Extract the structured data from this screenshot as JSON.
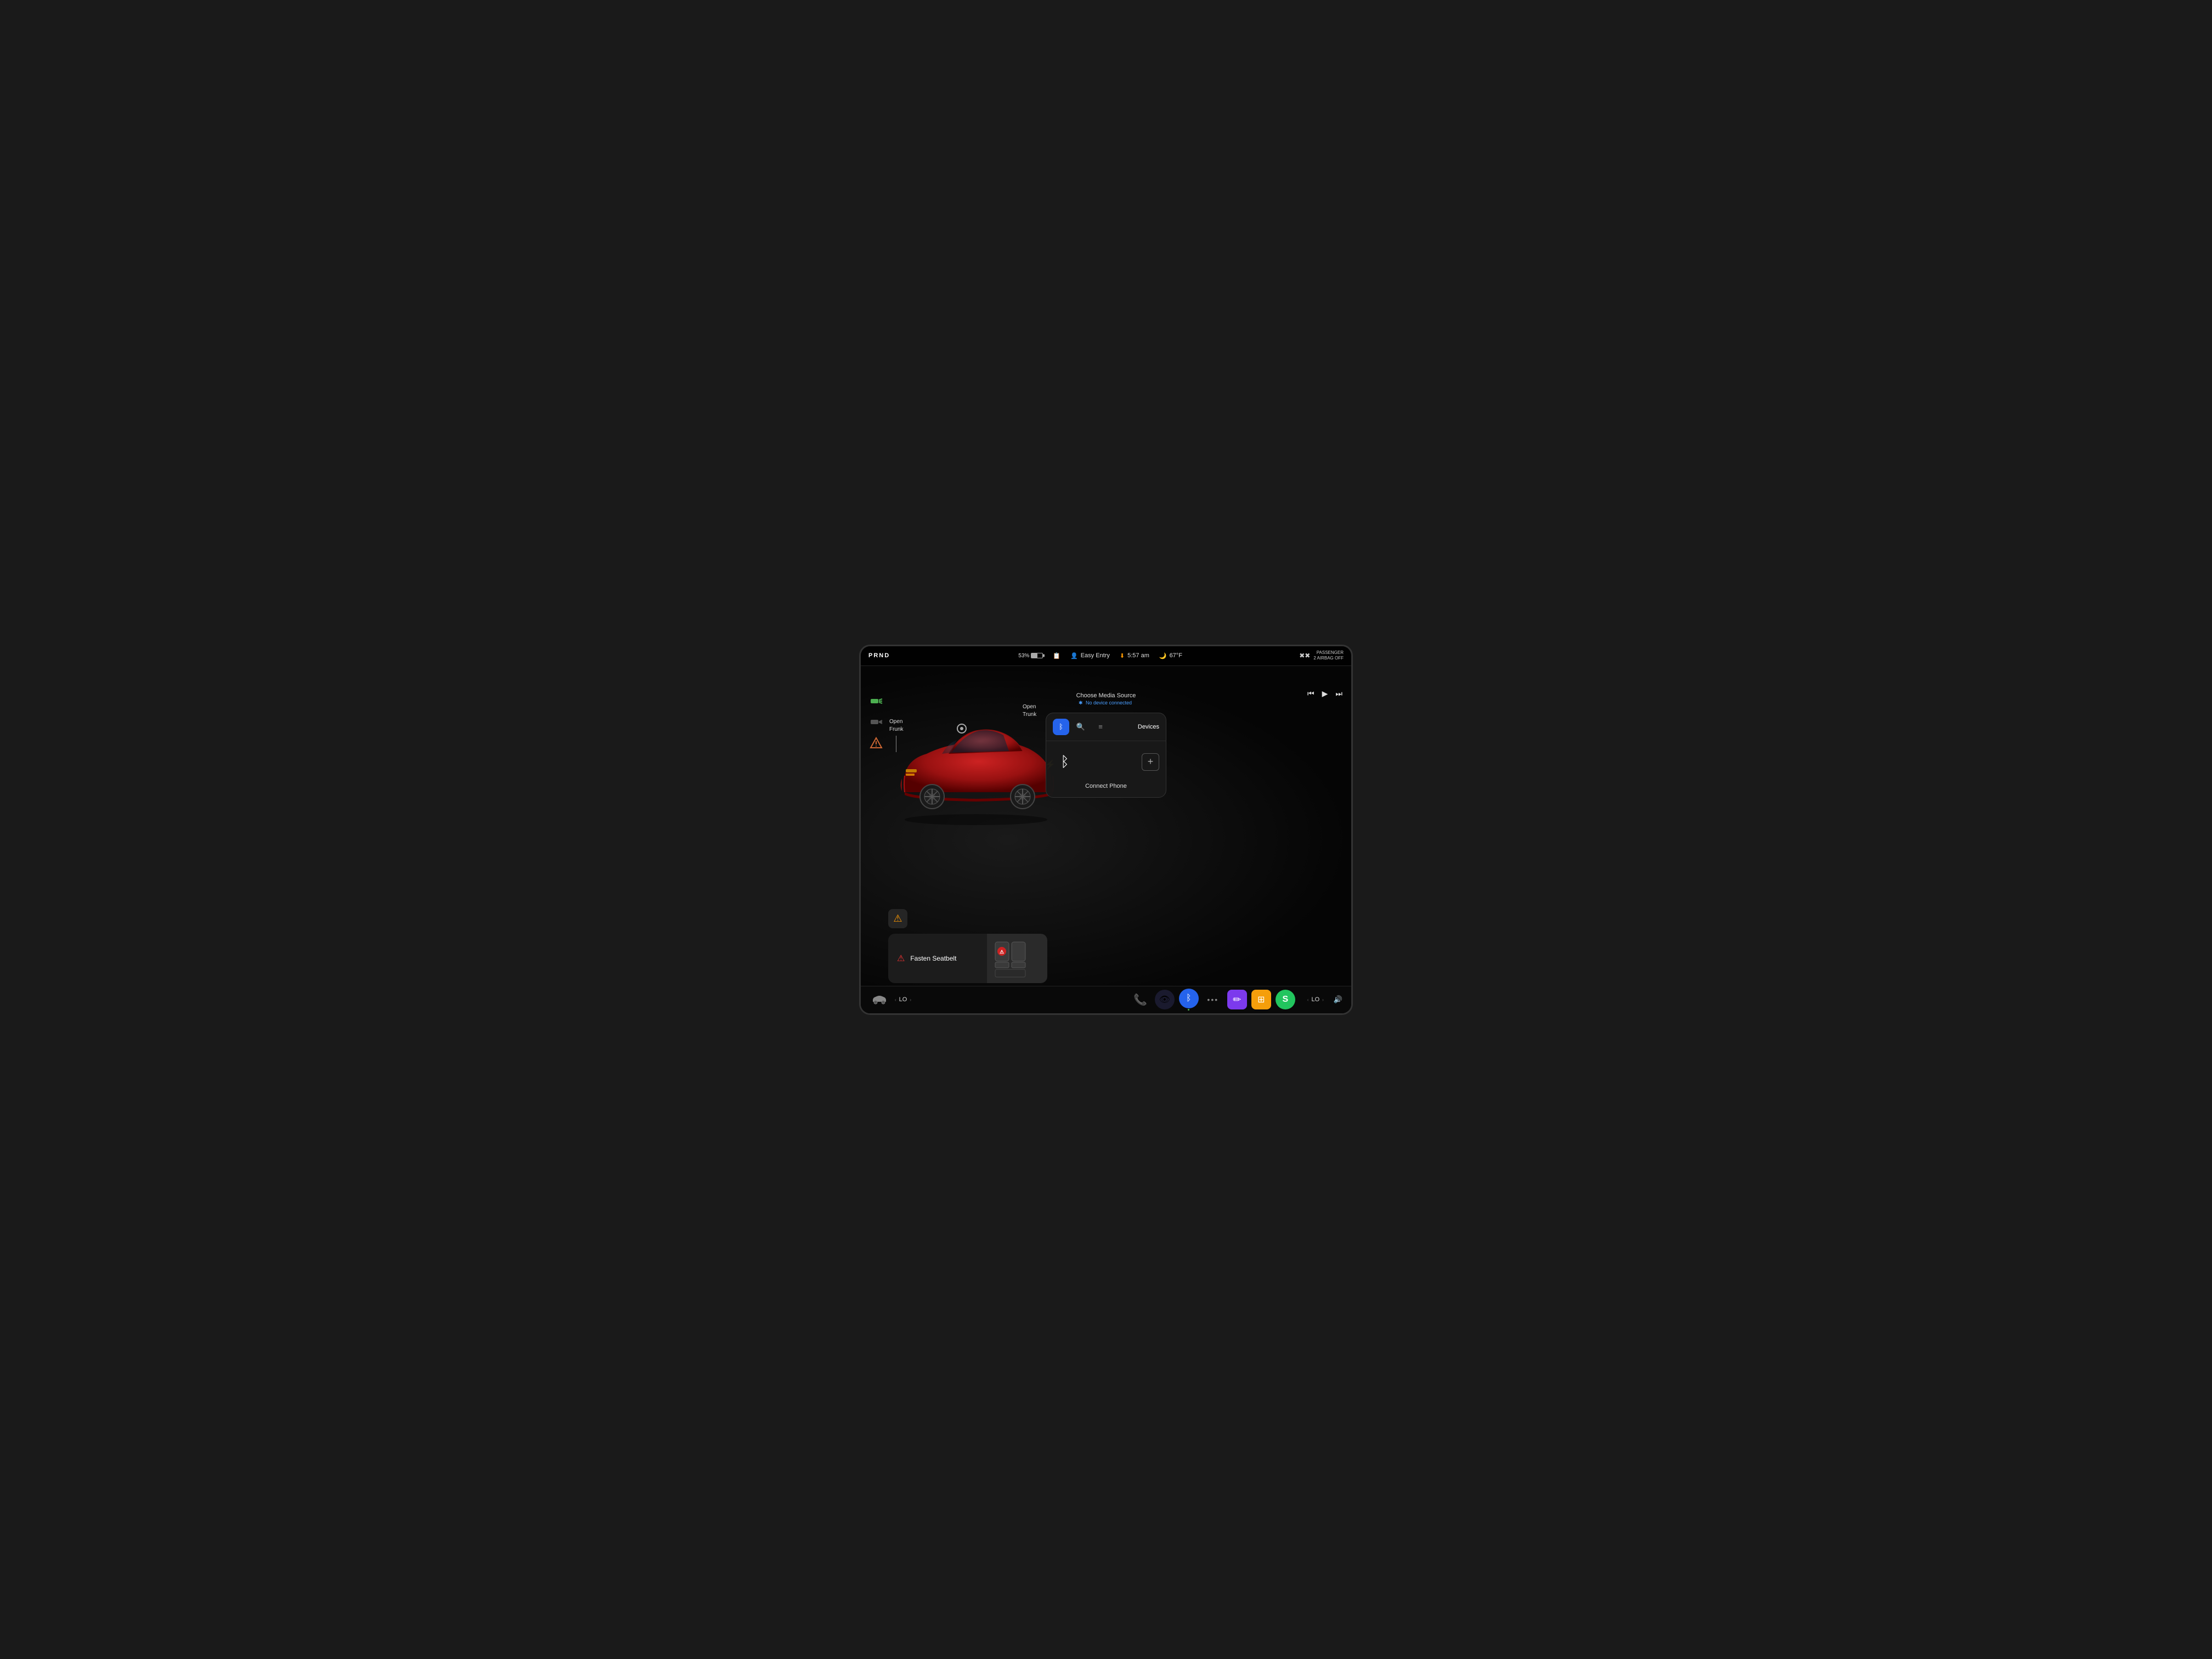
{
  "statusBar": {
    "prnd": "PRND",
    "battery": "53%",
    "easyEntry": "Easy Entry",
    "time": "5:57 am",
    "temperature": "67°F",
    "passengerAirbag": "PASSENGER AIRBAG OFF",
    "passengerAirbagLine2": "2"
  },
  "leftIcons": {
    "headlightsIcon": "💡",
    "beamIcon": "🔆",
    "hazardIcon": "🔥"
  },
  "carLabels": {
    "openFrunk": "Open\nFrunk",
    "openTrunk": "Open\nTrunk",
    "chargeIcon": "⚡"
  },
  "mediaSource": {
    "title": "Choose Media Source",
    "subtitle": "No device connected",
    "bluetoothIcon": "✱"
  },
  "mediaControls": {
    "prevIcon": "⏮",
    "playIcon": "▶",
    "nextIcon": "⏭"
  },
  "bluetoothPanel": {
    "tabBluetooth": "bluetooth",
    "tabSearch": "search",
    "tabList": "list",
    "tabLabel": "Devices",
    "connectLabel": "Connect Phone",
    "addIcon": "+"
  },
  "warnings": {
    "warningIcon": "⚠",
    "seatbeltText": "Fasten Seatbelt",
    "seatbeltIcon": "⚠"
  },
  "taskbar": {
    "carIcon": "🚗",
    "leftTempLabel": "LO",
    "rightTempLabel": "LO",
    "apps": [
      {
        "name": "phone",
        "icon": "📞",
        "bg": "transparent"
      },
      {
        "name": "camera",
        "icon": "📷",
        "bg": "#1a1a2e"
      },
      {
        "name": "bluetooth",
        "icon": "ᛒ",
        "bg": "#2563eb"
      },
      {
        "name": "dots",
        "icon": "•••",
        "bg": "transparent"
      },
      {
        "name": "pen",
        "icon": "✏",
        "bg": "#7c3aed"
      },
      {
        "name": "layers",
        "icon": "⊞",
        "bg": "#f59e0b"
      },
      {
        "name": "dollar",
        "icon": "S",
        "bg": "#22c55e"
      }
    ],
    "volumeIcon": "🔊"
  }
}
